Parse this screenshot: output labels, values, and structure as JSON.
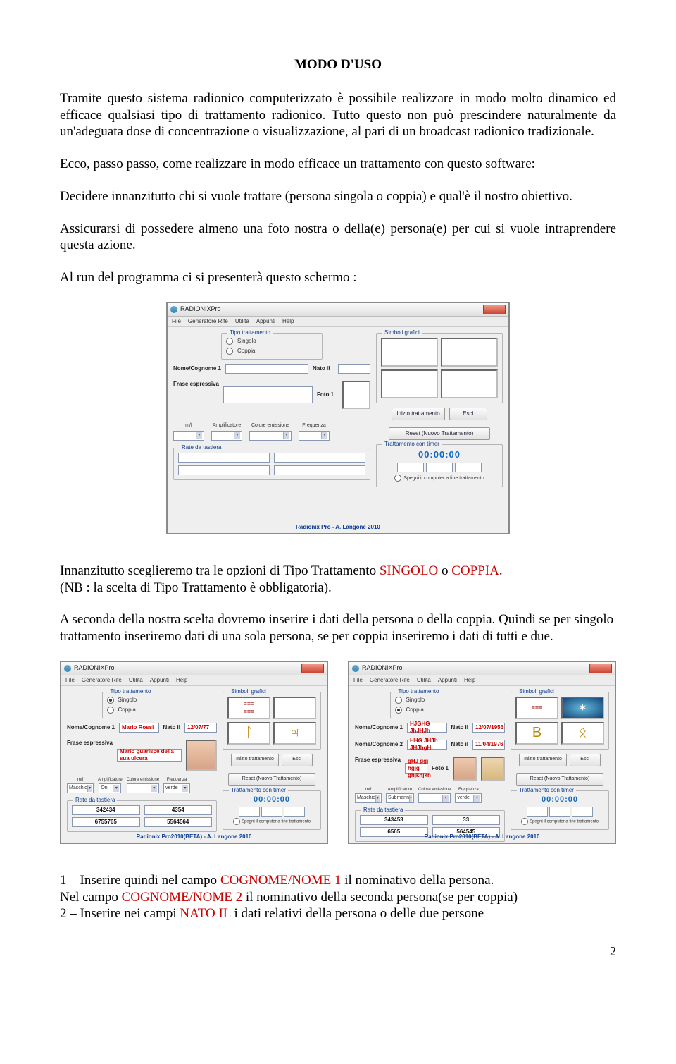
{
  "title": "MODO D'USO",
  "paragraphs": {
    "p1": "Tramite questo sistema radionico computerizzato è possibile realizzare in modo molto dinamico ed efficace  qualsiasi tipo di trattamento radionico. Tutto questo non può prescindere naturalmente da un'adeguata dose di concentrazione o visualizzazione, al pari di un broadcast radionico tradizionale.",
    "p2": "Ecco, passo passo, come realizzare in modo efficace un trattamento con questo software:",
    "p3": "Decidere innanzitutto chi si vuole trattare  (persona singola o coppia) e qual'è il nostro obiettivo.",
    "p4": "Assicurarsi di possedere almeno una foto nostra o  della(e) persona(e) per cui si vuole intraprendere questa azione.",
    "p5": "Al run del programma ci si presenterà questo schermo :",
    "p6a": "Innanzitutto sceglieremo tra le opzioni  di Tipo Trattamento ",
    "p6b": "SINGOLO",
    "p6c": " o ",
    "p6d": "COPPIA",
    "p6e": ".",
    "p7": "(NB : la scelta di Tipo Trattamento è obbligatoria).",
    "p8": "A seconda della nostra scelta dovremo inserire i dati della persona  o della coppia. Quindi se per singolo trattamento inseriremo dati di una sola persona, se per coppia inseriremo i dati di tutti e due.",
    "p9a": "1 – Inserire quindi nel campo ",
    "p9b": "COGNOME/NOME 1",
    "p9c": " il  nominativo della persona.",
    "p10a": "Nel campo ",
    "p10b": "COGNOME/NOME 2",
    "p10c": " il nominativo della seconda persona(se per coppia)",
    "p11a": "2 – Inserire nei campi ",
    "p11b": "NATO IL",
    "p11c": "  i dati relativi della persona o delle due persone"
  },
  "app": {
    "title": "RADIONIXPro",
    "title_beta": "RADIONIX Pro2010(BETA)",
    "menu": [
      "File",
      "Generatore Rife",
      "Utilità",
      "Appunti",
      "Help"
    ],
    "groups": {
      "tipo": "Tipo trattamento",
      "simboli": "Simboli grafici",
      "rate": "Rate da tastiera",
      "timer": "Trattamento con timer"
    },
    "labels": {
      "singolo": "Singolo",
      "coppia": "Coppia",
      "nome1": "Nome/Cognome 1",
      "nome2": "Nome/Cognome 2",
      "nato": "Nato il",
      "foto1": "Foto 1",
      "frase": "Frase espressiva",
      "mf": "m/f",
      "amp": "Amplificatore",
      "colore": "Colore emissione",
      "freq": "Frequenza",
      "maschio": "Maschio",
      "on": "On",
      "verde": "verde",
      "sottomann": "Submann",
      "inizio": "Inizio trattamento",
      "esci": "Esci",
      "reset": "Reset (Nuovo Trattamento)",
      "spegni": "Spegni il computer a fine trattamento",
      "credit": "Radionix Pro - A. Langone 2010",
      "credit_beta": "Radionix Pro2010(BETA) - A. Langone 2010",
      "timerval": "00:00:00"
    }
  },
  "sample_singolo": {
    "nome1": "Mario Rossi",
    "nato1": "12/07/77",
    "frase": "Mario guarisce della sua ulcera",
    "rates": [
      "342434",
      "4354",
      "6755765",
      "5564564"
    ]
  },
  "sample_coppia": {
    "nome1": "HJGHG JhJHJh",
    "nome2": "HHG JHJh JHJhgH",
    "nato1": "12/07/1956",
    "nato2": "11/04/1976",
    "frase": "gHJ ggj hgjg ghjkhjkh",
    "rates": [
      "343453",
      "33",
      "6565",
      "564545"
    ]
  },
  "page_number": "2"
}
